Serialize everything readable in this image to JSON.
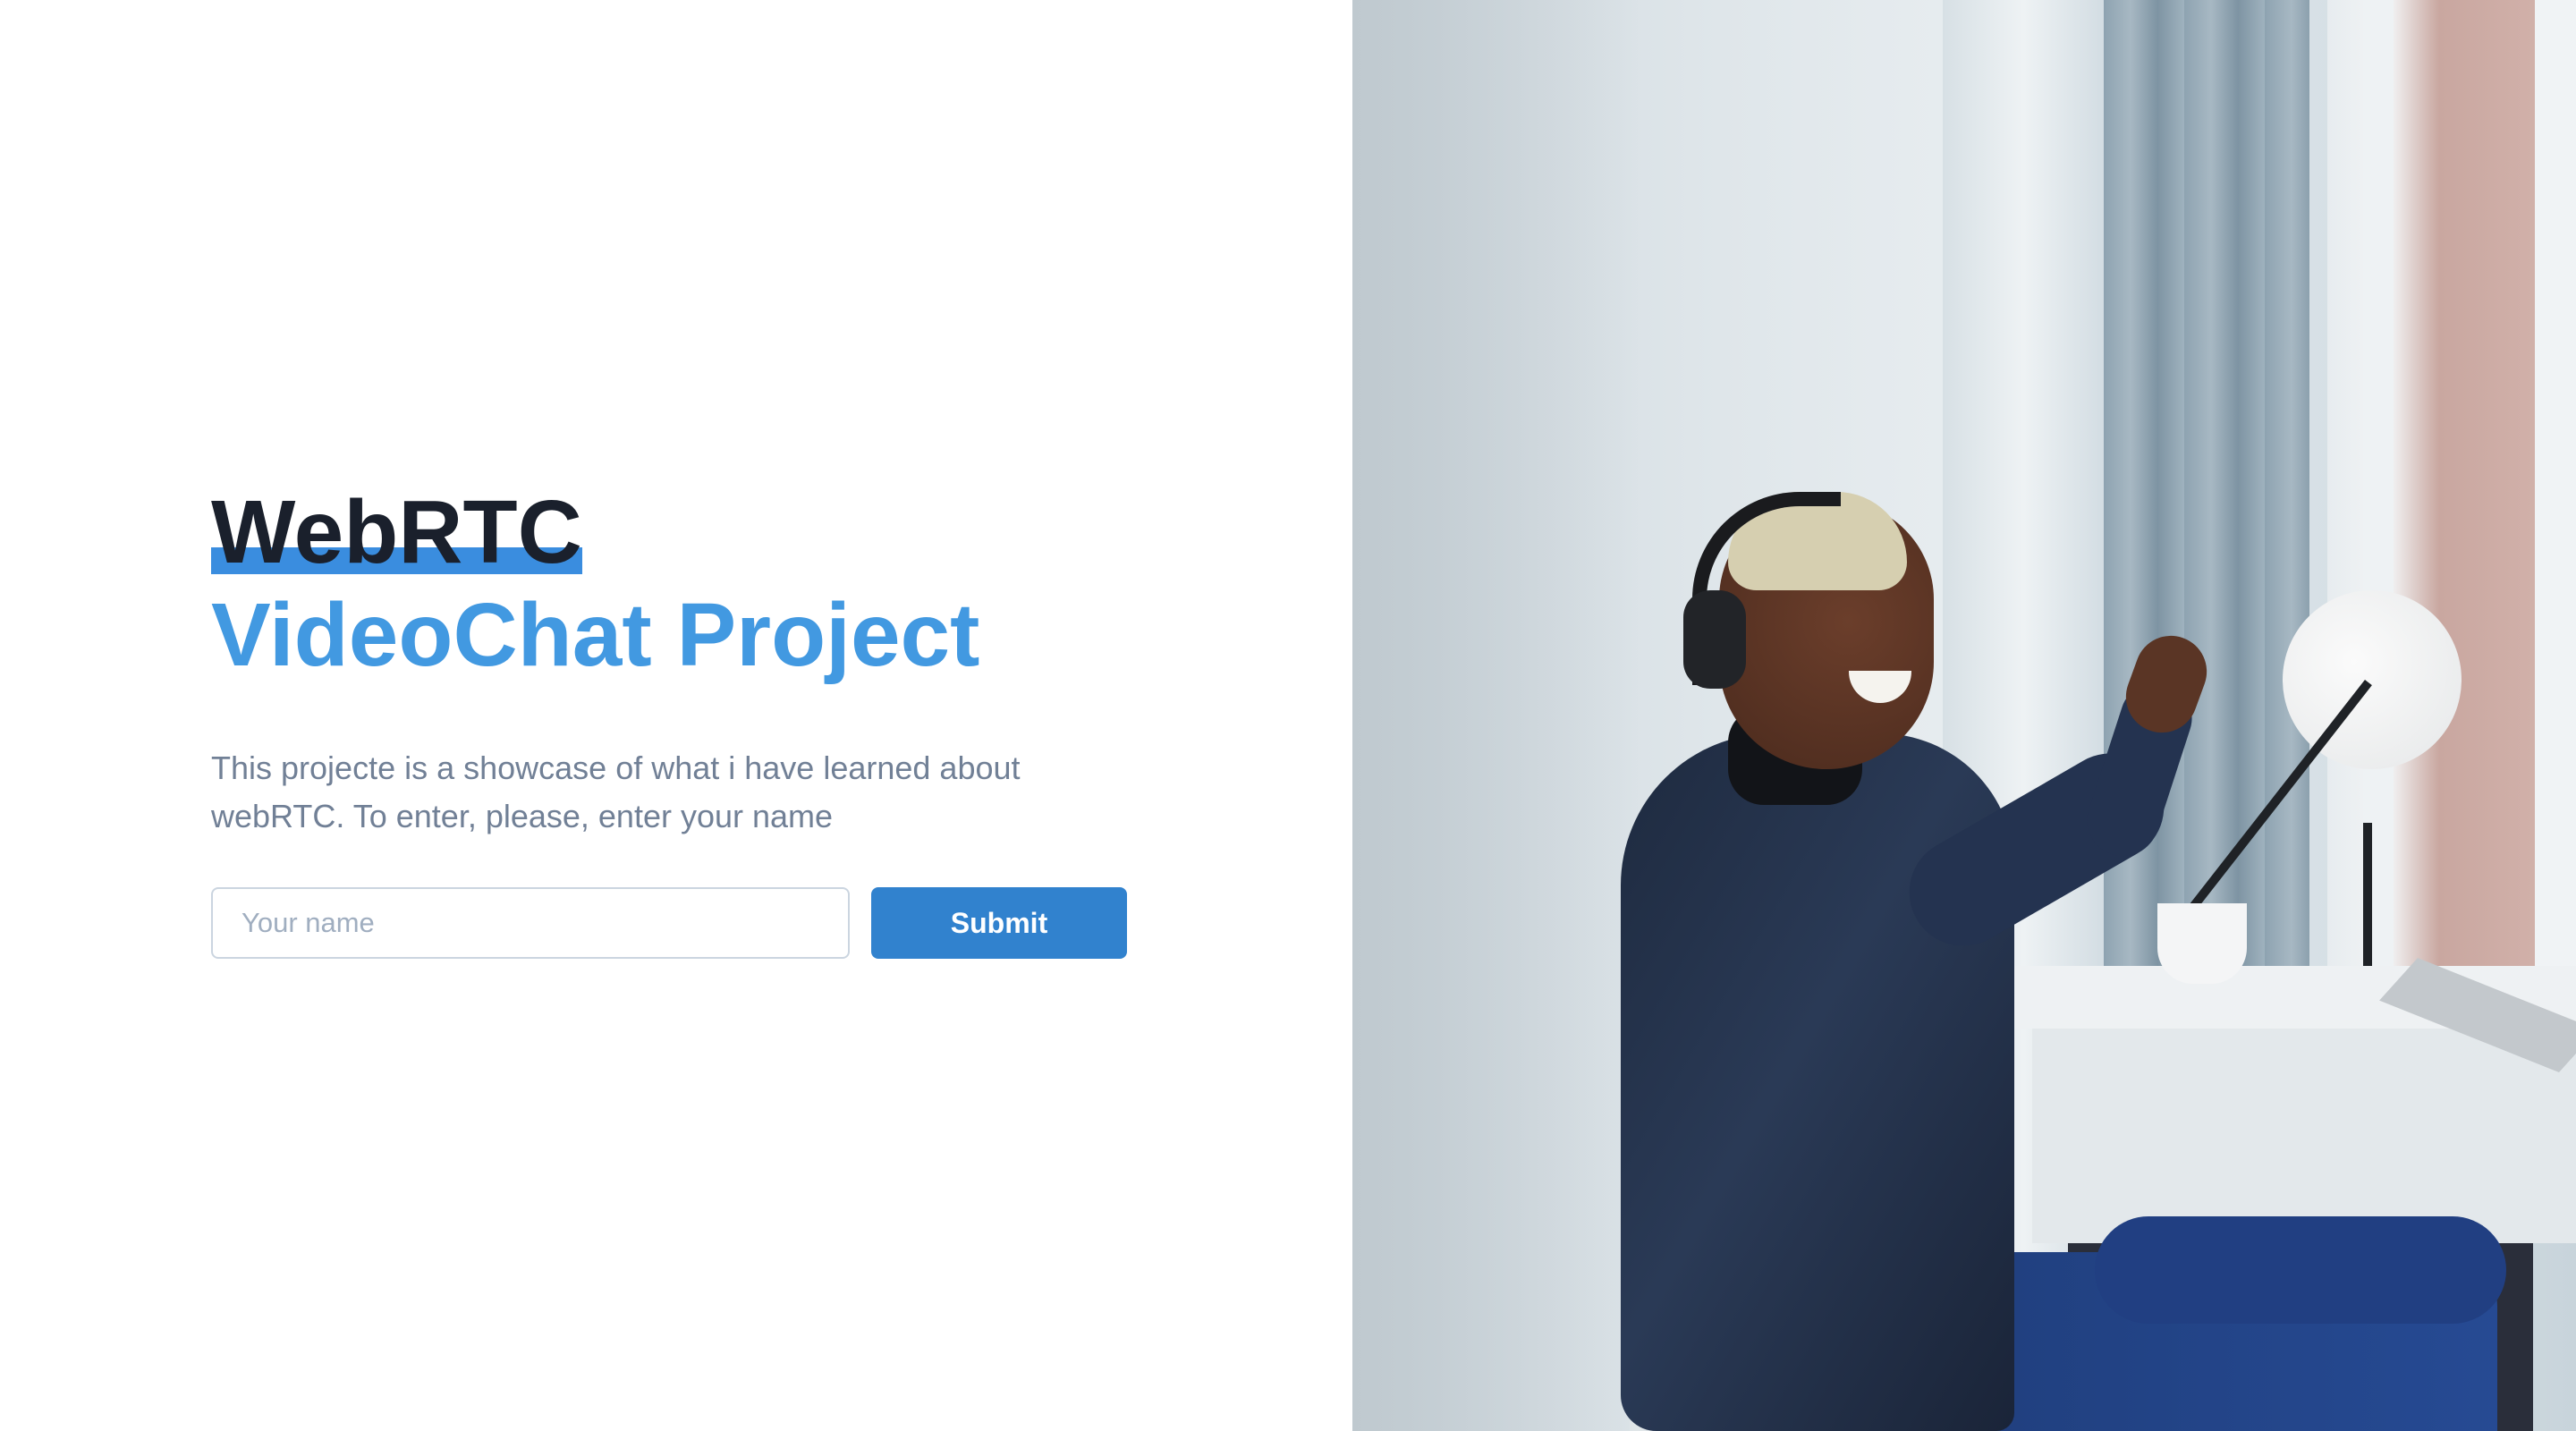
{
  "hero": {
    "title_line1": "WebRTC",
    "title_line2": "VideoChat Project",
    "description": "This projecte is a showcase of what i have learned about webRTC. To enter, please, enter your name"
  },
  "form": {
    "name_placeholder": "Your name",
    "name_value": "",
    "submit_label": "Submit"
  },
  "colors": {
    "accent": "#4299e1",
    "button": "#3182ce",
    "title_dark": "#1a202c",
    "text_muted": "#718096"
  },
  "image": {
    "subject": "smiling man wearing headphones at a desk by a window"
  }
}
